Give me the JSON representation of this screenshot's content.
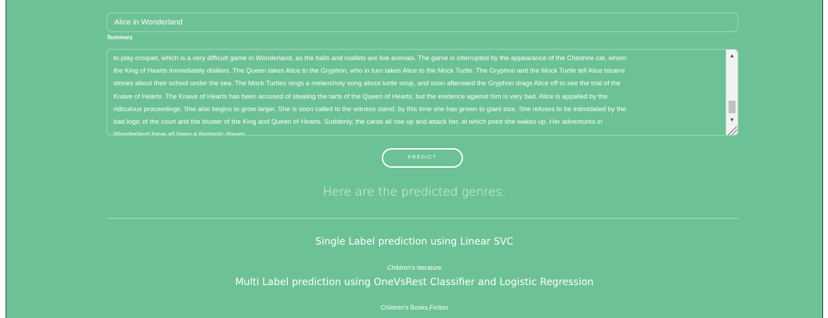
{
  "form": {
    "title_value": "Alice in Wonderland",
    "summary_label": "Summary",
    "summary_lines": [
      "to play croquet, which is a very difficult game in Wonderland, as the balls and mallets are live animals. The game is interrupted by the appearance of the Cheshire cat, whom",
      "the King of Hearts immediately dislikes. The Queen takes Alice to the Gryphon, who in turn takes Alice to the Mock Turtle. The Gryphon and the Mock Turtle tell Alice bizarre",
      "stories about their school under the sea. The Mock Turtles sings a melancholy song about turtle soup, and soon afterward the Gryphon drags Alice off to see the trial of the",
      "Knave of Hearts. The Knave of Hearts has been accused of stealing the tarts of the Queen of Hearts, but the evidence against him is very bad. Alice is appalled by the",
      "ridiculous proceedings. She also begins to grow larger. She is soon called to the witness stand; by this time she has grown to giant size. She refuses to be intimidated by the",
      "bad logic of the court and the bluster of the King and Queen of Hearts. Suddenly, the cards all rise up and attack her, at which point she wakes up. Her adventures in",
      "Wonderland have all been a fantastic dream."
    ],
    "predict_label": "PREDICT"
  },
  "results": {
    "heading": "Here are the predicted genres:",
    "single_label_heading": "Single Label prediction using Linear SVC",
    "single_label_result": "Children's literature",
    "multi_label_heading": "Multi Label prediction using OneVsRest Classifier and Logistic Regression",
    "multi_label_result": "Children's Books,Fiction"
  },
  "colors": {
    "background": "#6cc295",
    "text": "#ffffff"
  },
  "icons": {
    "scroll_up": "triangle-up-icon",
    "scroll_down": "triangle-down-icon",
    "resize": "resize-grip-icon"
  }
}
